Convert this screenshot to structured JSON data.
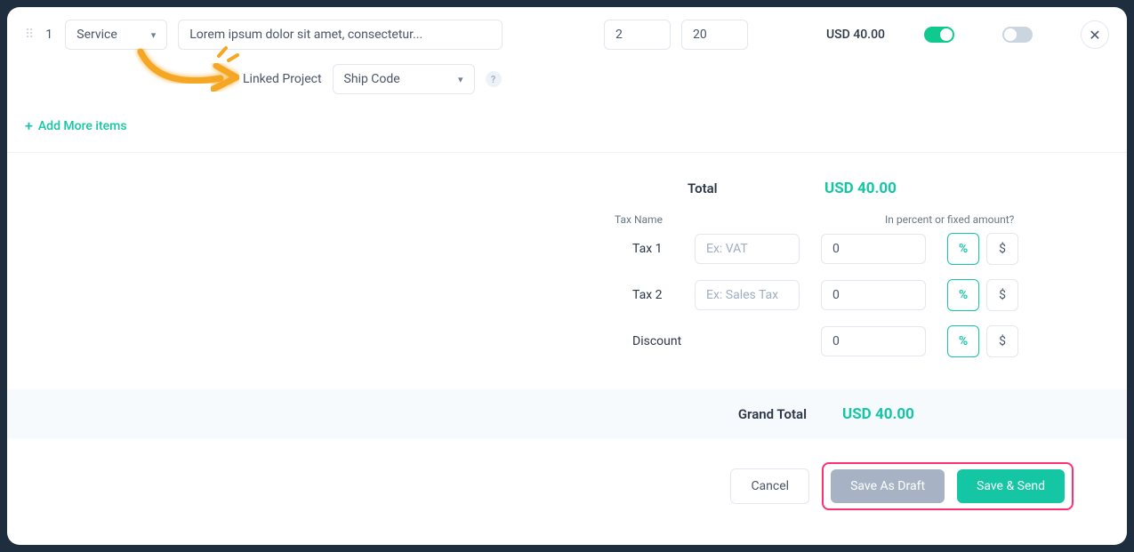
{
  "item": {
    "num": "1",
    "type": "Service",
    "description": "Lorem ipsum dolor sit amet, consectetur...",
    "qty": "2",
    "price": "20",
    "lineTotal": "USD 40.00"
  },
  "linked": {
    "label": "Linked Project",
    "value": "Ship Code"
  },
  "addMore": "Add More items",
  "totals": {
    "totalLabel": "Total",
    "totalValue": "USD 40.00",
    "taxNameHeader": "Tax Name",
    "percentOrFixed": "In percent or fixed amount?",
    "tax1Label": "Tax 1",
    "tax1Placeholder": "Ex: VAT",
    "tax1Value": "0",
    "tax2Label": "Tax 2",
    "tax2Placeholder": "Ex: Sales Tax",
    "tax2Value": "0",
    "discountLabel": "Discount",
    "discountValue": "0",
    "percentSymbol": "%",
    "dollarSymbol": "$"
  },
  "grand": {
    "label": "Grand Total",
    "value": "USD 40.00"
  },
  "actions": {
    "cancel": "Cancel",
    "draft": "Save As Draft",
    "send": "Save & Send"
  }
}
